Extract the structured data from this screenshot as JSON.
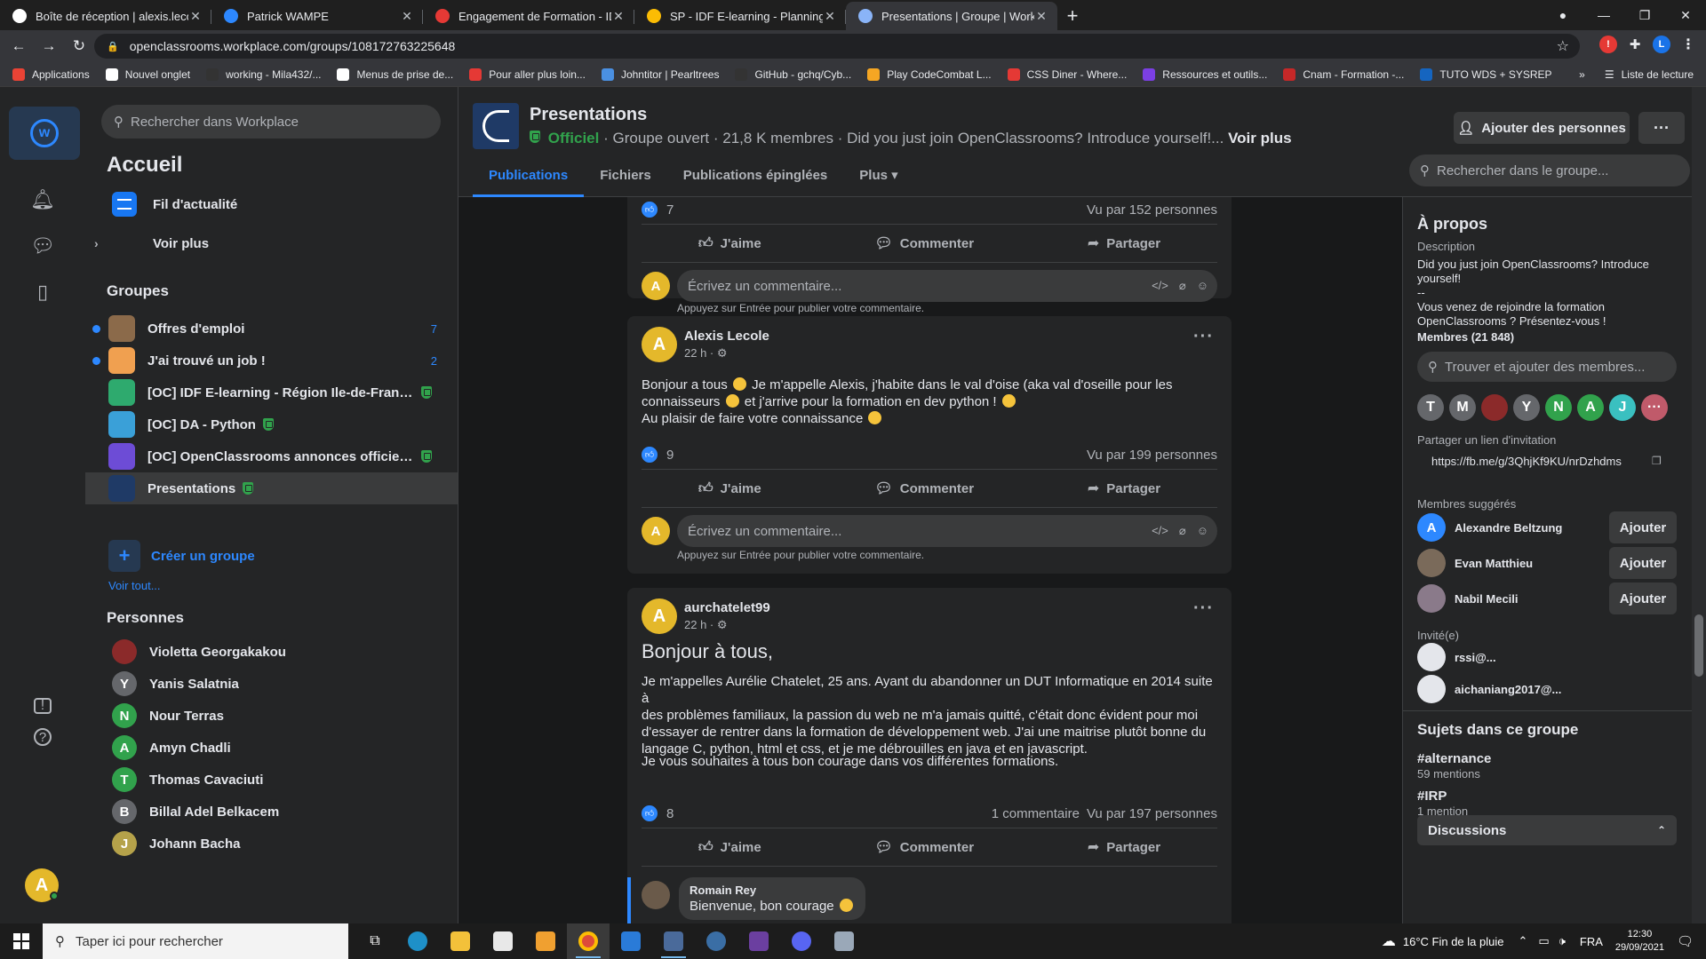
{
  "browser": {
    "tabs": [
      {
        "title": "Boîte de réception | alexis.lecole",
        "icon": "gmail-icon",
        "color": "#ffffff"
      },
      {
        "title": "Patrick WAMPE",
        "icon": "workplace-icon",
        "color": "#2d88ff"
      },
      {
        "title": "Engagement de Formation - IDF",
        "icon": "doc-icon",
        "color": "#e53935"
      },
      {
        "title": "SP - IDF E-learning - Planning - D",
        "icon": "drive-icon",
        "color": "#fbbc04"
      },
      {
        "title": "Presentations | Groupe | Workpla",
        "icon": "workplace-icon",
        "color": "#8ab4f8",
        "active": true
      }
    ],
    "url": "openclassrooms.workplace.com/groups/108172763225648",
    "profile_initial": "L",
    "bookmarks": [
      {
        "label": "Applications",
        "color": "#ea4335"
      },
      {
        "label": "Nouvel onglet",
        "color": "#ffffff"
      },
      {
        "label": "working - Mila432/...",
        "color": "#333333"
      },
      {
        "label": "Menus de prise de...",
        "color": "#ffffff"
      },
      {
        "label": "Pour aller plus loin...",
        "color": "#e53935"
      },
      {
        "label": "Johntitor | Pearltrees",
        "color": "#4a90e2"
      },
      {
        "label": "GitHub - gchq/Cyb...",
        "color": "#333333"
      },
      {
        "label": "Play CodeCombat L...",
        "color": "#f5a623"
      },
      {
        "label": "CSS Diner - Where...",
        "color": "#e53935"
      },
      {
        "label": "Ressources et outils...",
        "color": "#7b3fe4"
      },
      {
        "label": "Cnam - Formation -...",
        "color": "#c62828"
      },
      {
        "label": "TUTO WDS + SYSREP",
        "color": "#1565c0"
      }
    ],
    "bookmarks_more": "»",
    "reading_list": "Liste de lecture"
  },
  "leftnav": {
    "search_placeholder": "Rechercher dans Workplace",
    "home_title": "Accueil",
    "home_items": [
      "Fil d'actualité",
      "Voir plus"
    ],
    "groups_title": "Groupes",
    "groups": [
      {
        "name": "Offres d'emploi",
        "count": "7",
        "unread": true,
        "color": "#8b6a4a"
      },
      {
        "name": "J'ai trouvé un job !",
        "count": "2",
        "unread": true,
        "color": "#f0a050"
      },
      {
        "name": "[OC] IDF E-learning - Région Ile-de-France...",
        "count": "",
        "unread": false,
        "color": "#2eaa6e"
      },
      {
        "name": "[OC] DA - Python",
        "count": "",
        "unread": false,
        "color": "#3aa0d8"
      },
      {
        "name": "[OC] OpenClassrooms annonces officielles",
        "count": "",
        "unread": false,
        "color": "#6d4cd6"
      },
      {
        "name": "Presentations",
        "count": "",
        "unread": false,
        "color": "#1f3a66",
        "selected": true
      }
    ],
    "create_group": "Créer un groupe",
    "see_all": "Voir tout...",
    "people_title": "Personnes",
    "people": [
      {
        "name": "Violetta Georgakakou",
        "initial": "",
        "color": "#8b2a2a"
      },
      {
        "name": "Yanis Salatnia",
        "initial": "Y",
        "color": "#65676b"
      },
      {
        "name": "Nour Terras",
        "initial": "N",
        "color": "#31a24c"
      },
      {
        "name": "Amyn Chadli",
        "initial": "A",
        "color": "#31a24c"
      },
      {
        "name": "Thomas Cavaciuti",
        "initial": "T",
        "color": "#31a24c"
      },
      {
        "name": "Billal Adel Belkacem",
        "initial": "B",
        "color": "#65676b"
      },
      {
        "name": "Johann Bacha",
        "initial": "J",
        "color": "#b5a24a"
      }
    ],
    "me_initial": "A"
  },
  "group": {
    "title": "Presentations",
    "official": "Officiel",
    "subtitle": "· Groupe ouvert · 21,8 K membres · Did you just join OpenClassrooms? Introduce yourself!...",
    "see_more": "Voir plus",
    "add_people": "Ajouter des personnes",
    "tabs": [
      "Publications",
      "Fichiers",
      "Publications épinglées",
      "Plus"
    ],
    "search_placeholder": "Rechercher dans le groupe..."
  },
  "feed": {
    "comment_placeholder": "Écrivez un commentaire...",
    "comment_hint": "Appuyez sur Entrée pour publier votre commentaire.",
    "actions": {
      "like": "J'aime",
      "comment": "Commenter",
      "share": "Partager"
    },
    "commenter_initial": "A",
    "post0": {
      "likes": "7",
      "views": "Vu par 152 personnes"
    },
    "post1": {
      "author": "Alexis Lecole",
      "initial": "A",
      "time": "22 h ·",
      "lines": [
        "Bonjour a tous",
        "Je m'appelle Alexis, j'habite dans le val d'oise (aka val d'oseille pour les",
        "connaisseurs",
        "et j'arrive pour la formation en dev python !",
        "Au plaisir de faire votre connaissance"
      ],
      "likes": "9",
      "views": "Vu par 199 personnes"
    },
    "post2": {
      "author": "aurchatelet99",
      "initial": "A",
      "time": "22 h ·",
      "headline": "Bonjour à tous,",
      "p1": [
        "Je m'appelles Aurélie Chatelet, 25 ans. Ayant du abandonner un DUT Informatique en 2014 suite à",
        "des problèmes familiaux, la passion du web ne m'a jamais quitté, c'était donc évident pour moi",
        "d'essayer de rentrer dans la formation de développement web. J'ai une maitrise plutôt bonne du",
        "langage C, python, html et css, et je me débrouilles en java et en javascript."
      ],
      "p2": "Je vous souhaites à tous bon courage dans vos différentes formations.",
      "likes": "8",
      "comments": "1 commentaire",
      "views": "Vu par 197 personnes",
      "reply": {
        "author": "Romain Rey",
        "text": "Bienvenue, bon courage"
      }
    }
  },
  "about": {
    "title": "À propos",
    "desc_label": "Description",
    "desc_lines": [
      "Did you just join OpenClassrooms? Introduce",
      "yourself!",
      "--",
      "Vous venez de rejoindre la formation",
      "OpenClassrooms ? Présentez-vous !"
    ],
    "members_label": "Membres (21 848)",
    "members_search": "Trouver et ajouter des membres...",
    "member_avatars": [
      {
        "initial": "T",
        "color": "#65676b"
      },
      {
        "initial": "M",
        "color": "#65676b"
      },
      {
        "initial": "",
        "color": "#8b2a2a"
      },
      {
        "initial": "Y",
        "color": "#65676b"
      },
      {
        "initial": "N",
        "color": "#31a24c"
      },
      {
        "initial": "A",
        "color": "#31a24c"
      },
      {
        "initial": "J",
        "color": "#3ac0c0"
      },
      {
        "initial": "···",
        "color": "#c05a6a"
      }
    ],
    "invite_label": "Partager un lien d'invitation",
    "invite_link": "https://fb.me/g/3QhjKf9KU/nrDzhdms",
    "suggested_label": "Membres suggérés",
    "suggested": [
      {
        "name": "Alexandre Beltzung",
        "initial": "A",
        "color": "#2d88ff"
      },
      {
        "name": "Evan Matthieu",
        "initial": "",
        "color": "#7a6a5a"
      },
      {
        "name": "Nabil Mecili",
        "initial": "",
        "color": "#8a7a8a"
      }
    ],
    "add_label": "Ajouter",
    "invited_label": "Invité(e)",
    "invited": [
      "rssi@...",
      "aichaniang2017@..."
    ],
    "topics_title": "Sujets dans ce groupe",
    "topics": [
      {
        "name": "#alternance",
        "count": "59 mentions"
      },
      {
        "name": "#IRP",
        "count": "1 mention"
      }
    ],
    "discussions": "Discussions"
  },
  "taskbar": {
    "search_placeholder": "Taper ici pour rechercher",
    "weather": "16°C  Fin de la pluie",
    "lang": "FRA",
    "time": "12:30",
    "date": "29/09/2021"
  }
}
